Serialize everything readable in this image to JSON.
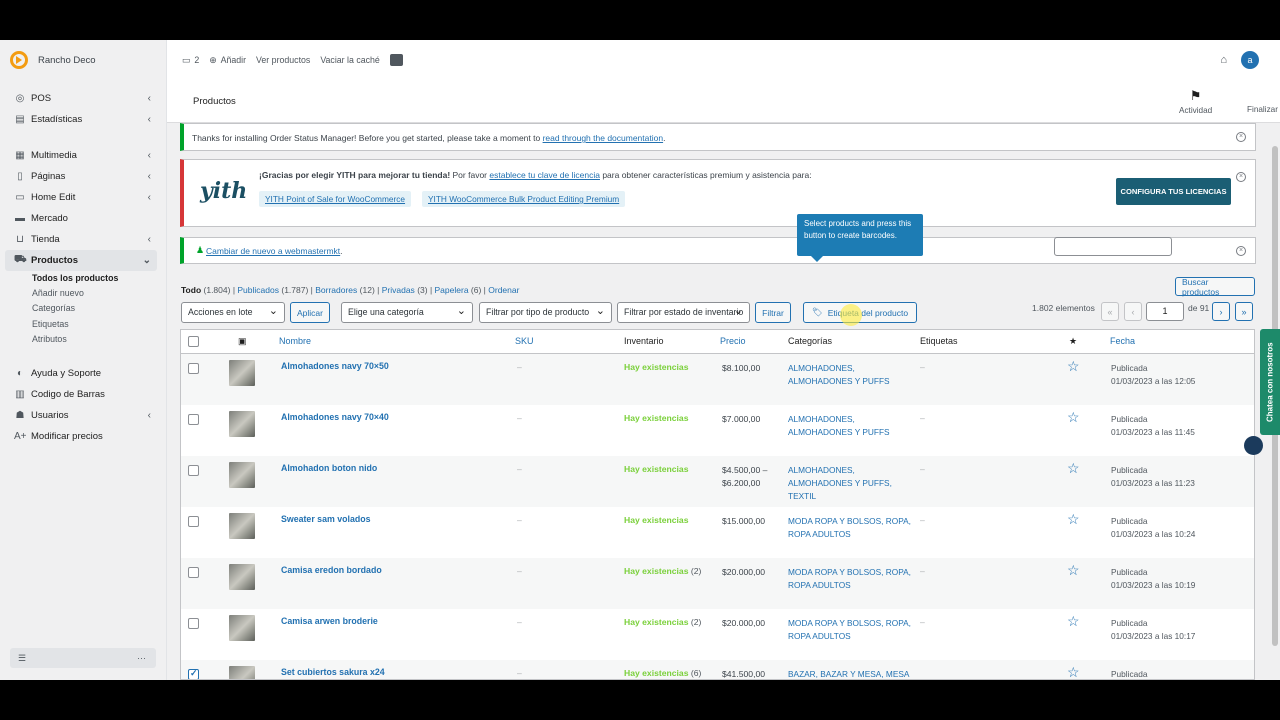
{
  "app": {
    "site_name": "Rancho Deco"
  },
  "sidebar": {
    "items": [
      {
        "label": "POS",
        "icon": "pos-icon",
        "chevron": true
      },
      {
        "label": "Estadísticas",
        "icon": "stats-icon",
        "chevron": true
      },
      {
        "label": "Multimedia",
        "icon": "media-icon",
        "chevron": true
      },
      {
        "label": "Páginas",
        "icon": "pages-icon",
        "chevron": true
      },
      {
        "label": "Home Edit",
        "icon": "home-edit-icon",
        "chevron": true
      },
      {
        "label": "Mercado",
        "icon": "market-icon",
        "chevron": false
      },
      {
        "label": "Tienda",
        "icon": "store-icon",
        "chevron": true
      },
      {
        "label": "Productos",
        "icon": "products-icon",
        "chevron": true
      }
    ],
    "sub_items": [
      "Todos los productos",
      "Añadir nuevo",
      "Categorías",
      "Etiquetas",
      "Atributos"
    ],
    "bottom_items": [
      {
        "label": "Ayuda y Soporte",
        "icon": "help-icon"
      },
      {
        "label": "Codigo de Barras",
        "icon": "barcode-icon"
      },
      {
        "label": "Usuarios",
        "icon": "users-icon"
      },
      {
        "label": "Modificar precios",
        "icon": "price-icon"
      }
    ]
  },
  "topbar": {
    "comments_count": "2",
    "add_label": "Añadir",
    "view_products": "Ver productos",
    "clear_cache": "Vaciar la caché",
    "avatar_letter": "a"
  },
  "header": {
    "title": "Productos",
    "activity": "Actividad",
    "finish": "Finalizar"
  },
  "notices": {
    "order_status_text": "Thanks for installing Order Status Manager! Before you get started, please take a moment to ",
    "order_status_link": "read through the documentation",
    "yith_logo": "yith",
    "yith_bold": "¡Gracias por elegir YITH para mejorar tu tienda!",
    "yith_text_1": " Por favor ",
    "yith_link": "establece tu clave de licencia",
    "yith_text_2": " para obtener características premium y asistencia para:",
    "yith_tag_1": "YITH Point of Sale for WooCommerce",
    "yith_tag_2": "YITH WooCommerce Bulk Product Editing Premium",
    "yith_button": "CONFIGURA TUS LICENCIAS",
    "switch_link": "Cambiar de nuevo a webmastermkt"
  },
  "filters": {
    "todo": "Todo",
    "todo_count": "(1.804)",
    "publicados": "Publicados",
    "publicados_count": "(1.787)",
    "borradores": "Borradores",
    "borradores_count": "(12)",
    "privadas": "Privadas",
    "privadas_count": "(3)",
    "papelera": "Papelera",
    "papelera_count": "(6)",
    "ordenar": "Ordenar",
    "bulk_action": "Acciones en lote",
    "apply": "Aplicar",
    "category": "Elige una categoría",
    "type": "Filtrar por tipo de producto",
    "stock": "Filtrar por estado de inventario",
    "filter_btn": "Filtrar",
    "label_btn": "Etiqueta del producto",
    "tooltip": "Select products and press this button to create barcodes.",
    "search_btn": "Buscar productos",
    "items_count": "1.802 elementos",
    "page": "1",
    "of_pages": "de 91"
  },
  "table": {
    "headers": {
      "name": "Nombre",
      "sku": "SKU",
      "inventory": "Inventario",
      "price": "Precio",
      "categories": "Categorías",
      "tags": "Etiquetas",
      "date": "Fecha"
    },
    "rows": [
      {
        "name": "Almohadones navy 70×50",
        "sku": "–",
        "inv": "Hay existencias",
        "inv_count": "",
        "price": "$8.100,00",
        "price2": "",
        "cats": "ALMOHADONES, ALMOHADONES Y PUFFS",
        "tags": "–",
        "status": "Publicada",
        "date": "01/03/2023 a las 12:05",
        "checked": false
      },
      {
        "name": "Almohadones navy 70×40",
        "sku": "–",
        "inv": "Hay existencias",
        "inv_count": "",
        "price": "$7.000,00",
        "price2": "",
        "cats": "ALMOHADONES, ALMOHADONES Y PUFFS",
        "tags": "–",
        "status": "Publicada",
        "date": "01/03/2023 a las 11:45",
        "checked": false
      },
      {
        "name": "Almohadon boton nido",
        "sku": "–",
        "inv": "Hay existencias",
        "inv_count": "",
        "price": "$4.500,00 –",
        "price2": "$6.200,00",
        "cats": "ALMOHADONES, ALMOHADONES Y PUFFS, TEXTIL",
        "tags": "–",
        "status": "Publicada",
        "date": "01/03/2023 a las 11:23",
        "checked": false
      },
      {
        "name": "Sweater sam volados",
        "sku": "–",
        "inv": "Hay existencias",
        "inv_count": "",
        "price": "$15.000,00",
        "price2": "",
        "cats": "MODA ROPA Y BOLSOS, ROPA, ROPA ADULTOS",
        "tags": "–",
        "status": "Publicada",
        "date": "01/03/2023 a las 10:24",
        "checked": false
      },
      {
        "name": "Camisa eredon bordado",
        "sku": "–",
        "inv": "Hay existencias",
        "inv_count": "(2)",
        "price": "$20.000,00",
        "price2": "",
        "cats": "MODA ROPA Y BOLSOS, ROPA, ROPA ADULTOS",
        "tags": "–",
        "status": "Publicada",
        "date": "01/03/2023 a las 10:19",
        "checked": false
      },
      {
        "name": "Camisa arwen broderie",
        "sku": "–",
        "inv": "Hay existencias",
        "inv_count": "(2)",
        "price": "$20.000,00",
        "price2": "",
        "cats": "MODA ROPA Y BOLSOS, ROPA, ROPA ADULTOS",
        "tags": "–",
        "status": "Publicada",
        "date": "01/03/2023 a las 10:17",
        "checked": false
      },
      {
        "name": "Set cubiertos sakura x24",
        "sku": "–",
        "inv": "Hay existencias",
        "inv_count": "(6)",
        "price": "$41.500,00",
        "price2": "",
        "cats": "BAZAR, BAZAR Y MESA, MESA",
        "tags": "",
        "status": "Publicada",
        "date": "",
        "checked": true
      }
    ]
  },
  "chat": {
    "label": "Chatea con nosotros"
  }
}
